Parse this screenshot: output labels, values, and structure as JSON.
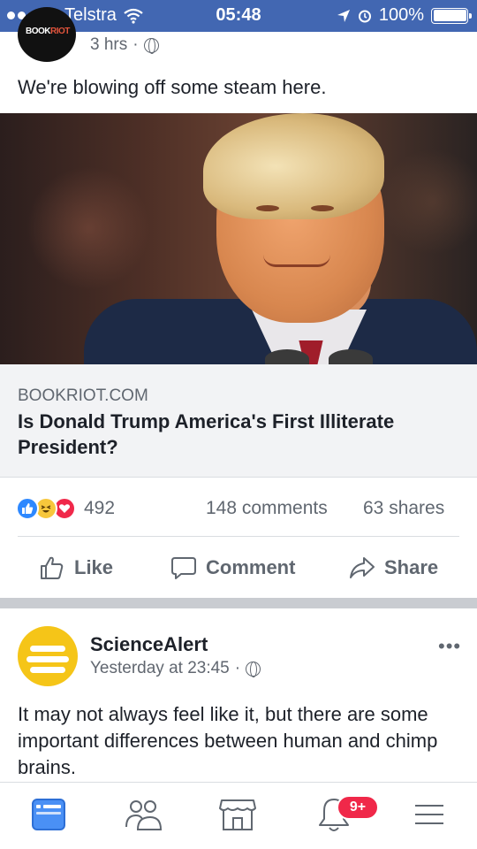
{
  "status_bar": {
    "carrier": "Telstra",
    "time": "05:48",
    "battery": "100%",
    "battery_level": 1.0
  },
  "post1": {
    "avatar_text_a": "BOOK",
    "avatar_text_b": "RIOT",
    "time": "3 hrs",
    "separator": "·",
    "text": "We're blowing off some steam here.",
    "link": {
      "domain": "BOOKRIOT.COM",
      "title": "Is Donald Trump America's First Illiterate President?"
    },
    "reaction_count": "492",
    "comments": "148 comments",
    "shares": "63 shares",
    "actions": {
      "like": "Like",
      "comment": "Comment",
      "share": "Share"
    }
  },
  "post2": {
    "author": "ScienceAlert",
    "time": "Yesterday at 23:45",
    "separator": "·",
    "more": "•••",
    "text": "It may not always feel like it, but there are some important differences between human and chimp brains."
  },
  "tab_bar": {
    "notifications_badge": "9+",
    "tabs": [
      "news-feed",
      "friends",
      "marketplace",
      "notifications",
      "menu"
    ]
  },
  "colors": {
    "brand": "#4267b2",
    "text_secondary": "#606770",
    "badge": "#f02849"
  }
}
